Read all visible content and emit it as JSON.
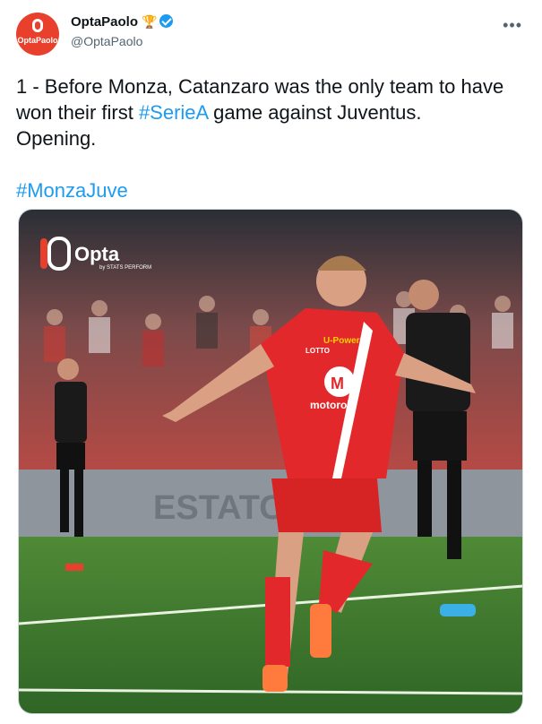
{
  "account": {
    "display_name": "OptaPaolo",
    "handle": "@OptaPaolo",
    "avatar_text": "OptaPaolo",
    "trophy_icon": "trophy-icon",
    "verified_icon": "verified-badge-icon"
  },
  "tweet": {
    "line1": "1 - Before Monza, Catanzaro was the only team to have",
    "line2_pre": "won their first ",
    "hashtag1": "#SerieA",
    "line2_post": " game against Juventus.",
    "line3": "Opening.",
    "hashtag2": "#MonzaJuve"
  },
  "media": {
    "overlay_brand": "Opta",
    "overlay_sub": "by STATS PERFORM",
    "shirt_sponsor": "motorola",
    "shirt_badge": "U-Power",
    "shirt_maker": "LOTTO",
    "board_text": "ESTATO TR",
    "colors": {
      "monza_red": "#e3282b",
      "juve_black": "#1a1a1a",
      "grass": "#3e7a2e",
      "accent": "#1d9bf0"
    }
  },
  "menu": {
    "more_label": "•••"
  }
}
